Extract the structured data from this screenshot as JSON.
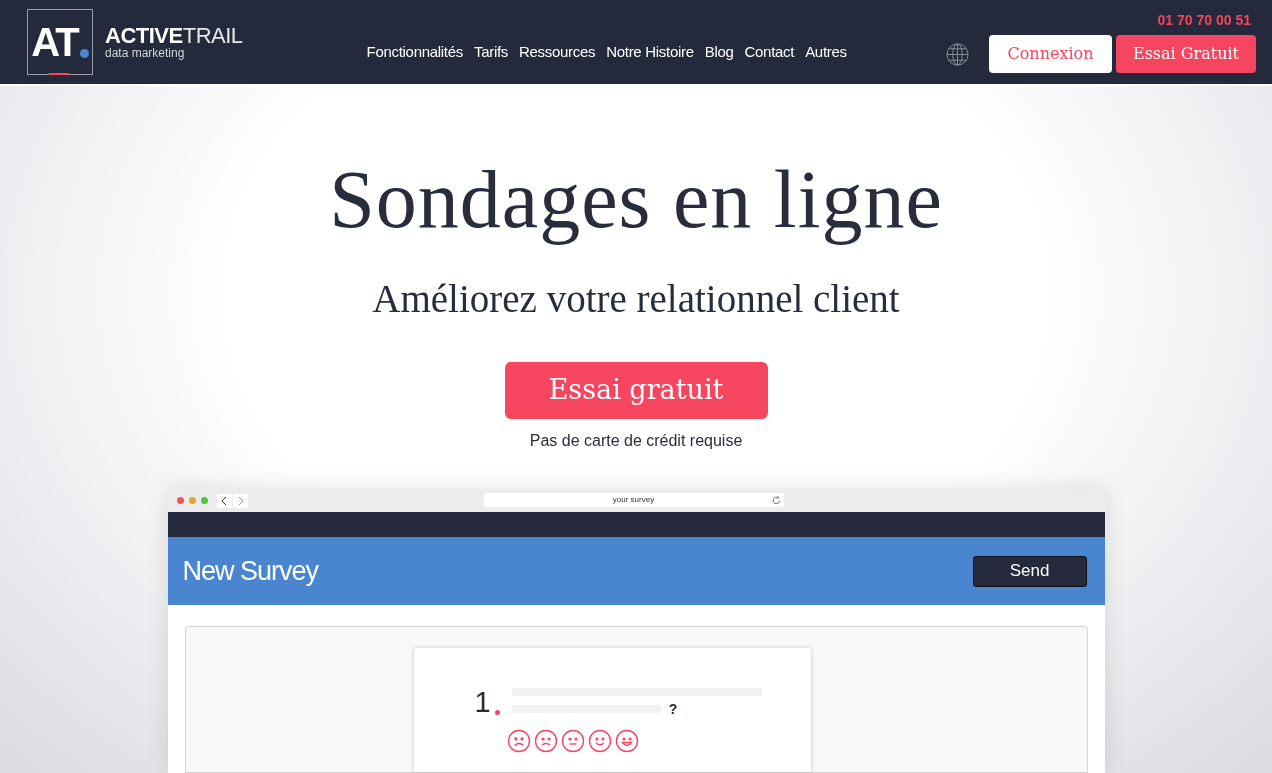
{
  "header": {
    "logo": {
      "mark": "AT",
      "brand_bold": "ACTIVE",
      "brand_light": "TRAIL",
      "tagline": "data marketing"
    },
    "nav": [
      "Fonctionnalités",
      "Tarifs",
      "Ressources",
      "Notre Histoire",
      "Blog",
      "Contact",
      "Autres"
    ],
    "phone": "01 70 70 00 51",
    "login_button": "Connexion",
    "trial_button": "Essai Gratuit"
  },
  "hero": {
    "title": "Sondages en ligne",
    "subtitle": "Améliorez votre relationnel client",
    "cta": "Essai gratuit",
    "note": "Pas de carte de crédit requise"
  },
  "mockup": {
    "address": "your survey",
    "survey_title": "New Survey",
    "send_button": "Send",
    "question": {
      "number": "1",
      "mark": "?"
    }
  }
}
